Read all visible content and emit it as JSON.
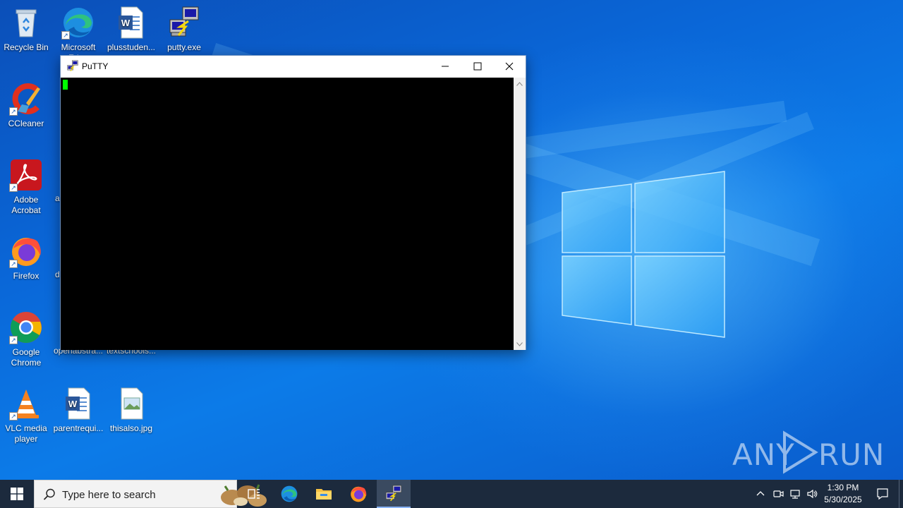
{
  "desktop": {
    "icons": [
      {
        "name": "recycle-bin",
        "label": "Recycle Bin"
      },
      {
        "name": "microsoft-edge",
        "label": "Microsoft Edge"
      },
      {
        "name": "plusstudent-doc",
        "label": "plusstuden..."
      },
      {
        "name": "putty-exe",
        "label": "putty.exe"
      },
      {
        "name": "ccleaner",
        "label": "CCleaner"
      },
      {
        "name": "adobe-acrobat",
        "label": "Adobe Acrobat"
      },
      {
        "name": "firefox",
        "label": "Firefox"
      },
      {
        "name": "google-chrome",
        "label": "Google Chrome"
      },
      {
        "name": "openabstract",
        "label": "openabstra..."
      },
      {
        "name": "textschools",
        "label": "textschools..."
      },
      {
        "name": "vlc",
        "label": "VLC media player"
      },
      {
        "name": "parentrequi-doc",
        "label": "parentrequi..."
      },
      {
        "name": "thisalso-jpg",
        "label": "thisalso.jpg"
      }
    ],
    "partial_labels": [
      "a",
      "d"
    ]
  },
  "putty_window": {
    "title": "PuTTY",
    "cursor_color": "#00ff00",
    "terminal_background": "#000000"
  },
  "watermark": {
    "left": "ANY",
    "right": "RUN"
  },
  "taskbar": {
    "search_placeholder": "Type here to search",
    "pinned_apps": [
      "task-view",
      "microsoft-edge",
      "file-explorer",
      "firefox",
      "putty"
    ],
    "active_app": "putty",
    "clock_time": "1:30 PM",
    "clock_date": "5/30/2025",
    "tray_icons": [
      "chevron-up-icon",
      "meet-now-icon",
      "network-icon",
      "volume-icon"
    ],
    "background_color": "#1c2a3d"
  },
  "colors": {
    "wallpaper_primary": "#0a67d8",
    "accent": "#8ab4f8"
  }
}
